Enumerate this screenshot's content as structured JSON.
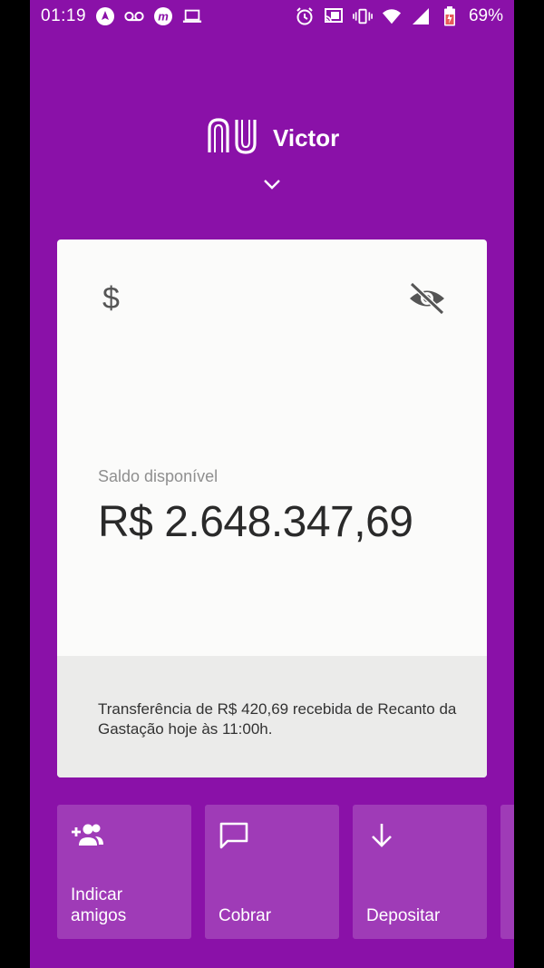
{
  "status_bar": {
    "time": "01:19",
    "battery_percent": "69%",
    "left_icons": [
      "navigation-icon",
      "voicemail-icon",
      "app-m-icon",
      "laptop-icon"
    ],
    "right_icons": [
      "alarm-icon",
      "cast-icon",
      "vibrate-icon",
      "wifi-icon",
      "signal-icon",
      "battery-icon"
    ]
  },
  "header": {
    "user_name": "Victor",
    "logo_icon": "nu-logo-icon",
    "dropdown_icon": "chevron-down-icon"
  },
  "account_card": {
    "currency_icon": "dollar-icon",
    "hide_balance_icon": "eye-off-icon",
    "balance_label": "Saldo disponível",
    "balance_value": "R$ 2.648.347,69",
    "notice": "Transferência de R$ 420,69 recebida de Recanto da Gastação hoje às 11:00h."
  },
  "shortcuts": [
    {
      "label": "Indicar amigos",
      "icon": "add-friends-icon"
    },
    {
      "label": "Cobrar",
      "icon": "message-icon"
    },
    {
      "label": "Depositar",
      "icon": "arrow-down-icon"
    }
  ],
  "colors": {
    "primary": "#8a11a8",
    "card": "#fbfbfa",
    "card_footer": "#ebebea"
  }
}
